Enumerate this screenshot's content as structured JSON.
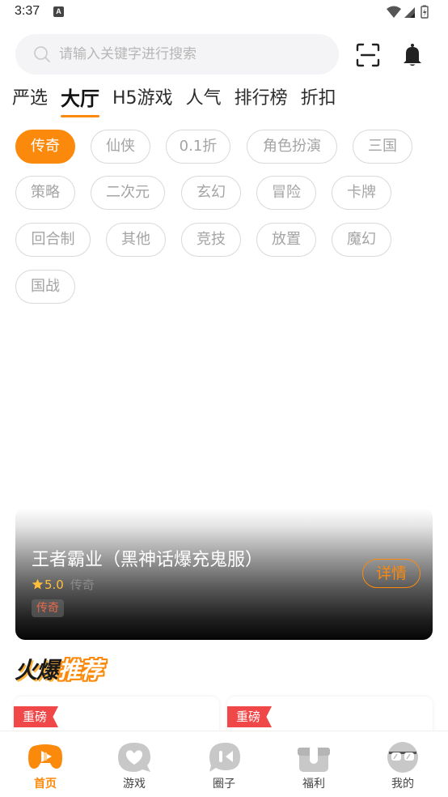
{
  "status_bar": {
    "time": "3:37",
    "notification_icon": "A"
  },
  "search": {
    "placeholder": "请输入关键字进行搜索",
    "scan_icon": "scan-icon",
    "bell_icon": "bell-icon"
  },
  "top_tabs": [
    {
      "label": "严选",
      "active": false
    },
    {
      "label": "大厅",
      "active": true
    },
    {
      "label": "H5游戏",
      "active": false
    },
    {
      "label": "人气",
      "active": false
    },
    {
      "label": "排行榜",
      "active": false
    },
    {
      "label": "折扣",
      "active": false
    }
  ],
  "categories": [
    "传奇",
    "仙侠",
    "0.1折",
    "角色扮演",
    "三国",
    "策略",
    "二次元",
    "玄幻",
    "冒险",
    "卡牌",
    "回合制",
    "其他",
    "竞技",
    "放置",
    "魔幻",
    "国战"
  ],
  "selected_category": "传奇",
  "featured": {
    "title": "王者霸业（黑神话爆充鬼服）",
    "rating": "5.0",
    "category": "传奇",
    "tag": "传奇",
    "detail_label": "详情"
  },
  "hot_section": {
    "title_part1": "火爆",
    "title_part2": "推荐"
  },
  "recommend_cards": [
    {
      "badge": "重磅"
    },
    {
      "badge": "重磅"
    }
  ],
  "bottom_nav": [
    {
      "label": "首页",
      "icon": "gamepad-icon",
      "active": true
    },
    {
      "label": "游戏",
      "icon": "heart-bubble-icon",
      "active": false
    },
    {
      "label": "圈子",
      "icon": "chat-bubble-icon",
      "active": false
    },
    {
      "label": "福利",
      "icon": "gift-icon",
      "active": false
    },
    {
      "label": "我的",
      "icon": "sunglasses-face-icon",
      "active": false
    }
  ],
  "colors": {
    "accent": "#fb8a0c",
    "badge_red": "#f04848",
    "chip_border": "#d9d9d9",
    "chip_text": "#a4a4a4",
    "inactive_icon": "#c8c8c8"
  }
}
